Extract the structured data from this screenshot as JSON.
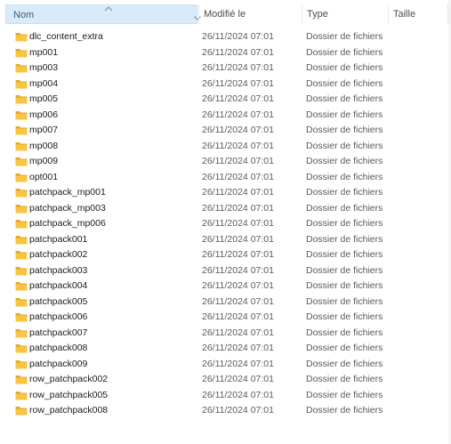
{
  "header": {
    "columns": {
      "name": "Nom",
      "modified": "Modifié le",
      "type": "Type",
      "size": "Taille"
    },
    "sort_column": "name",
    "sort_direction": "ascending"
  },
  "colors": {
    "selected_header_bg": "#d9ebf9",
    "folder_yellow": "#f8c543",
    "folder_dark": "#e2a82b"
  },
  "files": [
    {
      "name": "dlc_content_extra",
      "modified": "26/11/2024 07:01",
      "type": "Dossier de fichiers",
      "size": ""
    },
    {
      "name": "mp001",
      "modified": "26/11/2024 07:01",
      "type": "Dossier de fichiers",
      "size": ""
    },
    {
      "name": "mp003",
      "modified": "26/11/2024 07:01",
      "type": "Dossier de fichiers",
      "size": ""
    },
    {
      "name": "mp004",
      "modified": "26/11/2024 07:01",
      "type": "Dossier de fichiers",
      "size": ""
    },
    {
      "name": "mp005",
      "modified": "26/11/2024 07:01",
      "type": "Dossier de fichiers",
      "size": ""
    },
    {
      "name": "mp006",
      "modified": "26/11/2024 07:01",
      "type": "Dossier de fichiers",
      "size": ""
    },
    {
      "name": "mp007",
      "modified": "26/11/2024 07:01",
      "type": "Dossier de fichiers",
      "size": ""
    },
    {
      "name": "mp008",
      "modified": "26/11/2024 07:01",
      "type": "Dossier de fichiers",
      "size": ""
    },
    {
      "name": "mp009",
      "modified": "26/11/2024 07:01",
      "type": "Dossier de fichiers",
      "size": ""
    },
    {
      "name": "opt001",
      "modified": "26/11/2024 07:01",
      "type": "Dossier de fichiers",
      "size": ""
    },
    {
      "name": "patchpack_mp001",
      "modified": "26/11/2024 07:01",
      "type": "Dossier de fichiers",
      "size": ""
    },
    {
      "name": "patchpack_mp003",
      "modified": "26/11/2024 07:01",
      "type": "Dossier de fichiers",
      "size": ""
    },
    {
      "name": "patchpack_mp006",
      "modified": "26/11/2024 07:01",
      "type": "Dossier de fichiers",
      "size": ""
    },
    {
      "name": "patchpack001",
      "modified": "26/11/2024 07:01",
      "type": "Dossier de fichiers",
      "size": ""
    },
    {
      "name": "patchpack002",
      "modified": "26/11/2024 07:01",
      "type": "Dossier de fichiers",
      "size": ""
    },
    {
      "name": "patchpack003",
      "modified": "26/11/2024 07:01",
      "type": "Dossier de fichiers",
      "size": ""
    },
    {
      "name": "patchpack004",
      "modified": "26/11/2024 07:01",
      "type": "Dossier de fichiers",
      "size": ""
    },
    {
      "name": "patchpack005",
      "modified": "26/11/2024 07:01",
      "type": "Dossier de fichiers",
      "size": ""
    },
    {
      "name": "patchpack006",
      "modified": "26/11/2024 07:01",
      "type": "Dossier de fichiers",
      "size": ""
    },
    {
      "name": "patchpack007",
      "modified": "26/11/2024 07:01",
      "type": "Dossier de fichiers",
      "size": ""
    },
    {
      "name": "patchpack008",
      "modified": "26/11/2024 07:01",
      "type": "Dossier de fichiers",
      "size": ""
    },
    {
      "name": "patchpack009",
      "modified": "26/11/2024 07:01",
      "type": "Dossier de fichiers",
      "size": ""
    },
    {
      "name": "row_patchpack002",
      "modified": "26/11/2024 07:01",
      "type": "Dossier de fichiers",
      "size": ""
    },
    {
      "name": "row_patchpack005",
      "modified": "26/11/2024 07:01",
      "type": "Dossier de fichiers",
      "size": ""
    },
    {
      "name": "row_patchpack008",
      "modified": "26/11/2024 07:01",
      "type": "Dossier de fichiers",
      "size": ""
    }
  ]
}
